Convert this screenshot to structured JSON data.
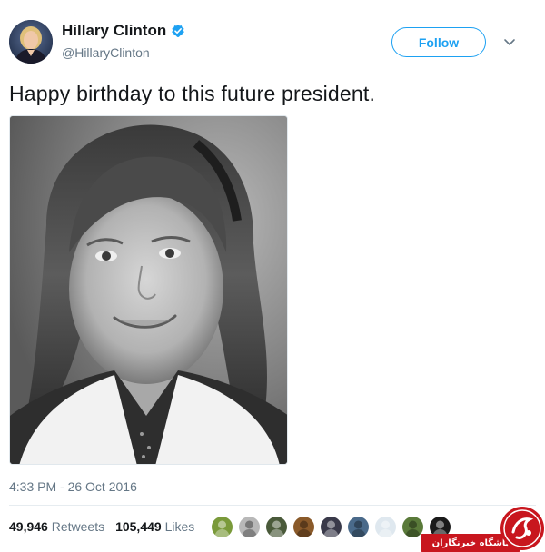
{
  "header": {
    "display_name": "Hillary Clinton",
    "handle": "@HillaryClinton",
    "follow_label": "Follow",
    "verified_icon": "verified-badge-icon",
    "menu_icon": "chevron-down-icon"
  },
  "tweet": {
    "text": "Happy birthday to this future president.",
    "timestamp": "4:33 PM - 26 Oct 2016",
    "photo_alt": "black and white portrait photo"
  },
  "stats": {
    "retweets_count": "49,946",
    "retweets_label": "Retweets",
    "likes_count": "105,449",
    "likes_label": "Likes"
  },
  "likers": [
    {
      "name": "liker-avatar-1",
      "color": "#7a9a3a"
    },
    {
      "name": "liker-avatar-2",
      "color": "#b8b8b8"
    },
    {
      "name": "liker-avatar-3",
      "color": "#4a5a3a"
    },
    {
      "name": "liker-avatar-4",
      "color": "#8a5a2a"
    },
    {
      "name": "liker-avatar-5",
      "color": "#3a3a4a"
    },
    {
      "name": "liker-avatar-6",
      "color": "#4a6a8a"
    },
    {
      "name": "liker-avatar-7",
      "color": "#dfe8ef"
    },
    {
      "name": "liker-avatar-8",
      "color": "#5a7a3a"
    },
    {
      "name": "liker-avatar-9",
      "color": "#1a1a1a"
    }
  ],
  "watermark": {
    "text": "باشگاه خبرنگاران"
  },
  "colors": {
    "accent": "#1da1f2",
    "text_primary": "#14171a",
    "text_secondary": "#657786",
    "watermark_red": "#c8161e"
  }
}
